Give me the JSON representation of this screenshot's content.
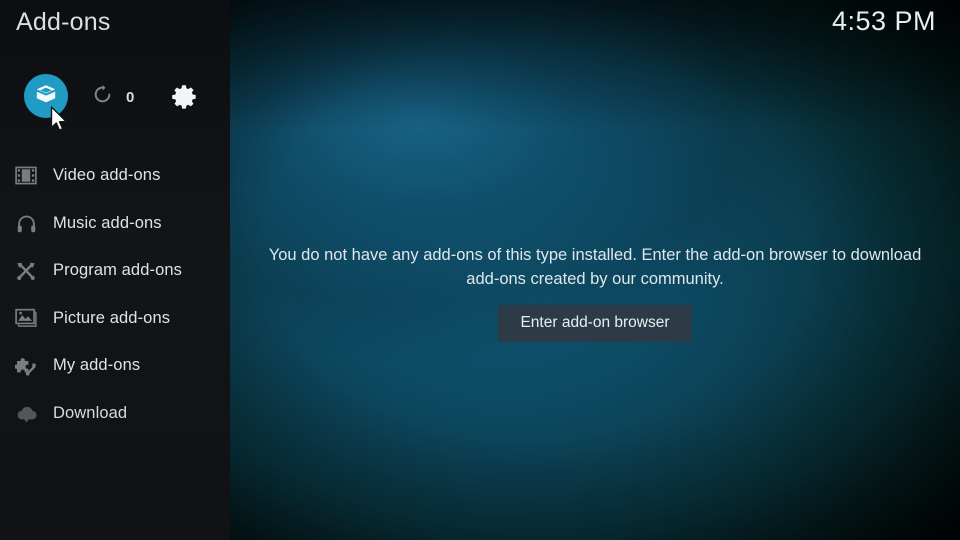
{
  "window": {
    "title": "Add-ons",
    "clock": "4:53 PM"
  },
  "actions": {
    "package_icon": "package-box-icon",
    "refresh_icon": "refresh-icon",
    "refresh_count": "0",
    "settings_icon": "gear-icon"
  },
  "sidebar": {
    "items": [
      {
        "label": "Video add-ons",
        "icon": "film-strip-icon"
      },
      {
        "label": "Music add-ons",
        "icon": "headphones-icon"
      },
      {
        "label": "Program add-ons",
        "icon": "tools-icon"
      },
      {
        "label": "Picture add-ons",
        "icon": "picture-icon"
      },
      {
        "label": "My add-ons",
        "icon": "puzzle-wrench-icon"
      },
      {
        "label": "Download",
        "icon": "cloud-download-icon"
      }
    ]
  },
  "main": {
    "empty_message": "You do not have any add-ons of this type installed. Enter the add-on browser to download add-ons created by our community.",
    "button_label": "Enter add-on browser"
  },
  "colors": {
    "accent_cyan": "#1f9bc4",
    "sidebar_bg": "#121418",
    "button_bg": "#2c3b45",
    "text_primary": "#dfe7ea",
    "background_teal": "#0f5470"
  },
  "cursor": {
    "icon": "mouse-pointer-icon"
  }
}
